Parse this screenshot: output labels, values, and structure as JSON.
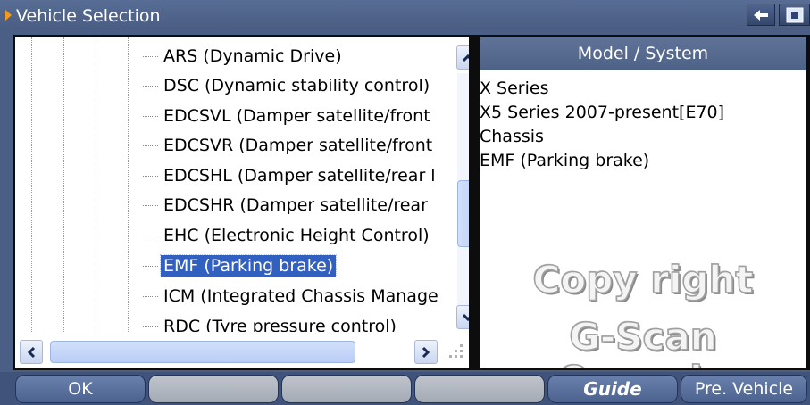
{
  "window": {
    "title": "Vehicle Selection",
    "back_icon": "arrow-left-icon",
    "home_icon": "home-icon"
  },
  "tree": {
    "items": [
      {
        "label": "ARS (Dynamic Drive)",
        "selected": false
      },
      {
        "label": "DSC (Dynamic stability control)",
        "selected": false
      },
      {
        "label": "EDCSVL (Damper satellite/front",
        "selected": false
      },
      {
        "label": "EDCSVR (Damper satellite/front",
        "selected": false
      },
      {
        "label": "EDCSHL (Damper satellite/rear l",
        "selected": false
      },
      {
        "label": "EDCSHR (Damper satellite/rear",
        "selected": false
      },
      {
        "label": "EHC (Electronic Height Control)",
        "selected": false
      },
      {
        "label": "EMF (Parking brake)",
        "selected": true
      },
      {
        "label": "ICM (Integrated Chassis Manage",
        "selected": false
      },
      {
        "label": "RDC (Tyre pressure control)",
        "selected": false
      }
    ]
  },
  "model_system": {
    "header": "Model / System",
    "lines": [
      "X Series",
      "X5 Series 2007-present[E70]",
      "Chassis",
      "EMF (Parking brake)"
    ]
  },
  "watermark": {
    "line1": "Copy right",
    "line2": "G-Scan Oceania"
  },
  "buttons": {
    "ok": "OK",
    "blank1": "",
    "blank2": "",
    "blank3": "",
    "guide": "Guide",
    "pre_vehicle": "Pre. Vehicle"
  },
  "colors": {
    "accent": "#f39a1e",
    "selection": "#3260c0",
    "titlebar": "#4b5f86"
  }
}
